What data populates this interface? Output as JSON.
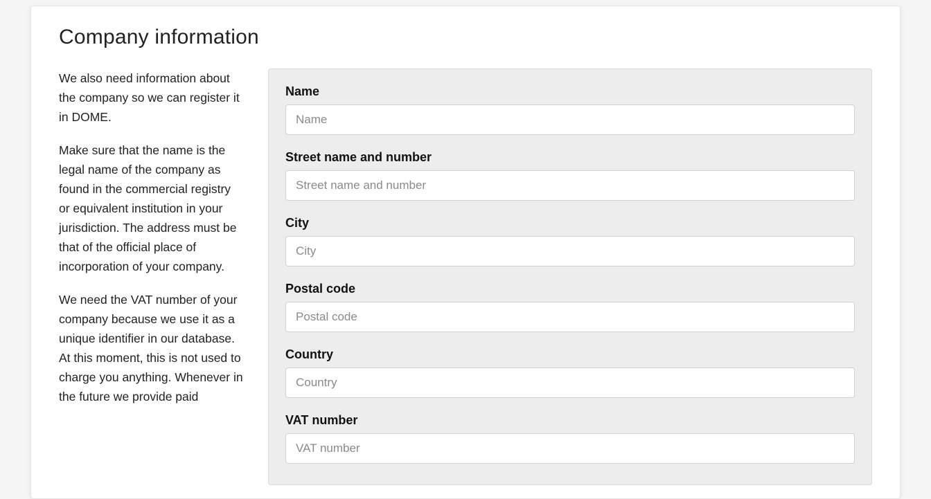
{
  "title": "Company information",
  "sidebar": {
    "p1": "We also need information about the company so we can register it in DOME.",
    "p2": "Make sure that the name is the legal name of the company as found in the commercial registry or equivalent institution in your jurisdiction. The address must be that of the official place of incorporation of your company.",
    "p3": "We need the VAT number of your company because we use it as a unique identifier in our database. At this moment, this is not used to charge you anything. Whenever in the future we provide paid"
  },
  "form": {
    "name": {
      "label": "Name",
      "placeholder": "Name",
      "value": ""
    },
    "street": {
      "label": "Street name and number",
      "placeholder": "Street name and number",
      "value": ""
    },
    "city": {
      "label": "City",
      "placeholder": "City",
      "value": ""
    },
    "postal": {
      "label": "Postal code",
      "placeholder": "Postal code",
      "value": ""
    },
    "country": {
      "label": "Country",
      "placeholder": "Country",
      "value": ""
    },
    "vat": {
      "label": "VAT number",
      "placeholder": "VAT number",
      "value": ""
    }
  }
}
